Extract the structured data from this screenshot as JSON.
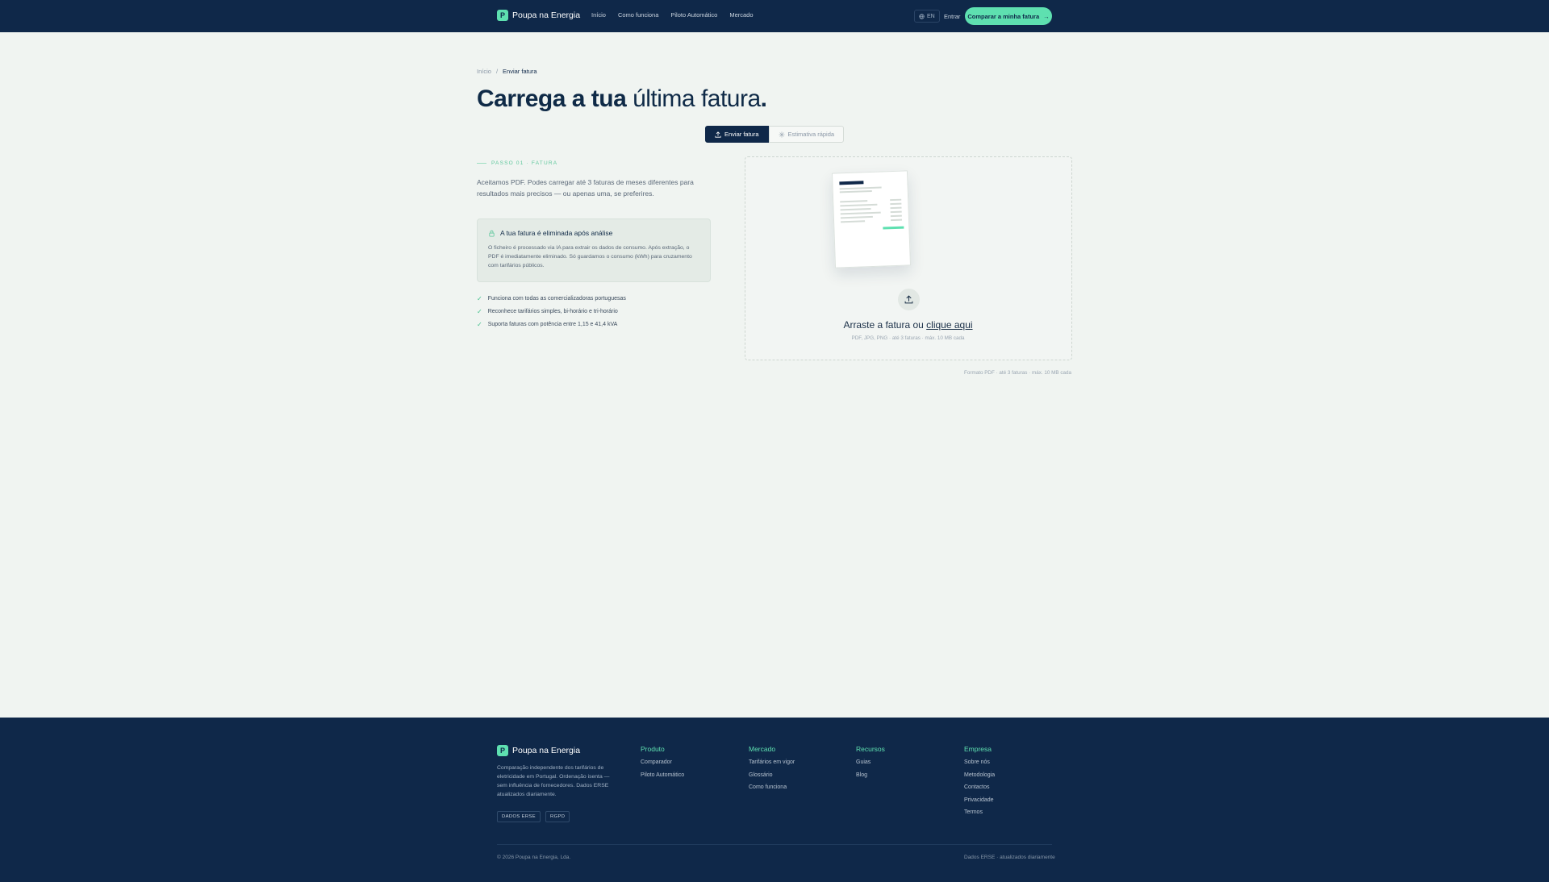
{
  "header": {
    "logo_mark": "P",
    "brand": "Poupa na Energia",
    "nav": [
      "Início",
      "Como funciona",
      "Piloto Automático",
      "Mercado"
    ],
    "lang": "EN",
    "login": "Entrar",
    "cta": "Comparar a minha fatura"
  },
  "breadcrumb": {
    "home": "Início",
    "sep": "/",
    "current": "Enviar fatura"
  },
  "title": {
    "bold": "Carrega a tua",
    "light": " última fatura",
    "dot": "."
  },
  "tabs": {
    "active": "Enviar fatura",
    "inactive": "Estimativa rápida"
  },
  "step_label": "PASSO 01 · FATURA",
  "intro": "Aceitamos PDF. Podes carregar até 3 faturas de meses diferentes para resultados mais precisos — ou apenas uma, se preferires.",
  "infobox": {
    "title": "A tua fatura é eliminada após análise",
    "body": "O ficheiro é processado via IA para extrair os dados de consumo. Após extração, o PDF é imediatamente eliminado. Só guardamos o consumo (kWh) para cruzamento com tarifários públicos."
  },
  "features": [
    "Funciona com todas as comercializadoras portuguesas",
    "Reconhece tarifários simples, bi-horário e tri-horário",
    "Suporta faturas com potência entre 1,15 e 41,4 kVA"
  ],
  "dropzone": {
    "text": "Arraste a fatura ou ",
    "link": "clique aqui",
    "sub": "PDF, JPG, PNG · até 3 faturas · máx. 10 MB cada"
  },
  "format_note": "Formato PDF · até 3 faturas · máx. 10 MB cada",
  "footer": {
    "description": "Comparação independente dos tarifários de eletricidade em Portugal. Ordenação isenta — sem influência de fornecedores. Dados ERSE atualizados diariamente.",
    "badges": [
      "DADOS ERSE",
      "RGPD"
    ],
    "columns": [
      {
        "title": "Produto",
        "items": [
          "Comparador",
          "Piloto Automático"
        ]
      },
      {
        "title": "Mercado",
        "items": [
          "Tarifários em vigor",
          "Glossário",
          "Como funciona"
        ]
      },
      {
        "title": "Recursos",
        "items": [
          "Guias",
          "Blog"
        ]
      },
      {
        "title": "Empresa",
        "items": [
          "Sobre nós",
          "Metodologia",
          "Contactos",
          "Privacidade",
          "Termos"
        ]
      }
    ],
    "copyright": "© 2026 Poupa na Energia, Lda.",
    "data_note": "Dados ERSE · atualizados diariamente"
  },
  "colors": {
    "navy": "#0f2849",
    "mint": "#5ee0b0",
    "background": "#f0f4f1"
  }
}
